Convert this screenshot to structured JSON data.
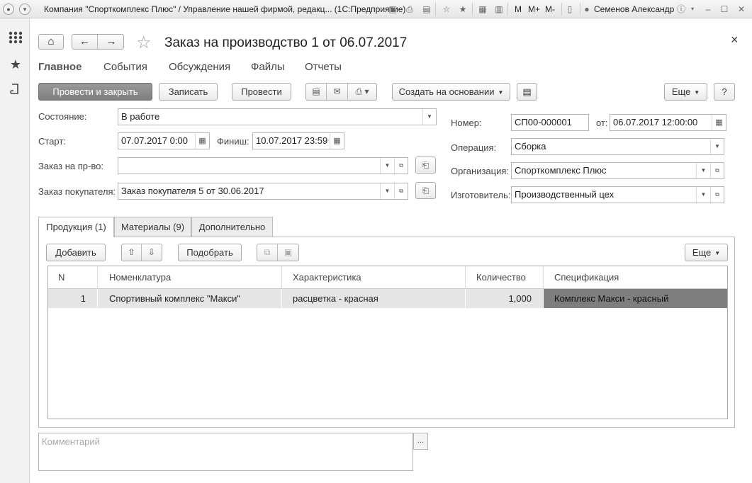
{
  "window": {
    "title": "Компания \"Спорткомплекс Плюс\" / Управление нашей фирмой, редакц... (1С:Предприятие)",
    "mem_buttons": [
      "M",
      "M+",
      "M-"
    ],
    "user": "Семенов Александр"
  },
  "header": {
    "title": "Заказ на производство 1 от 06.07.2017",
    "close": "×"
  },
  "sections": [
    "Главное",
    "События",
    "Обсуждения",
    "Файлы",
    "Отчеты"
  ],
  "toolbar": {
    "post_close": "Провести и закрыть",
    "save": "Записать",
    "post": "Провести",
    "create_based": "Создать на основании",
    "more": "Еще",
    "help": "?"
  },
  "form": {
    "state_label": "Состояние:",
    "state_value": "В работе",
    "start_label": "Старт:",
    "start_value": "07.07.2017  0:00",
    "finish_label": "Финиш:",
    "finish_value": "10.07.2017 23:59",
    "order_label": "Заказ на пр-во:",
    "order_value": "",
    "customer_order_label": "Заказ покупателя:",
    "customer_order_value": "Заказ покупателя 5 от 30.06.2017",
    "number_label": "Номер:",
    "number_value": "СП00-000001",
    "date_label": "от:",
    "date_value": "06.07.2017 12:00:00",
    "operation_label": "Операция:",
    "operation_value": "Сборка",
    "org_label": "Организация:",
    "org_value": "Спорткомплекс Плюс",
    "maker_label": "Изготовитель:",
    "maker_value": "Производственный цех"
  },
  "tabs": [
    "Продукция (1)",
    "Материалы (9)",
    "Дополнительно"
  ],
  "table_toolbar": {
    "add": "Добавить",
    "pick": "Подобрать",
    "more": "Еще"
  },
  "table": {
    "columns": [
      "N",
      "Номенклатура",
      "Характеристика",
      "Количество",
      "Спецификация"
    ],
    "rows": [
      {
        "n": "1",
        "item": "Спортивный комплекс \"Макси\"",
        "char": "расцветка - красная",
        "qty": "1,000",
        "spec": "Комплекс Макси - красный"
      }
    ]
  },
  "comment": {
    "placeholder": "Комментарий",
    "button": "..."
  }
}
